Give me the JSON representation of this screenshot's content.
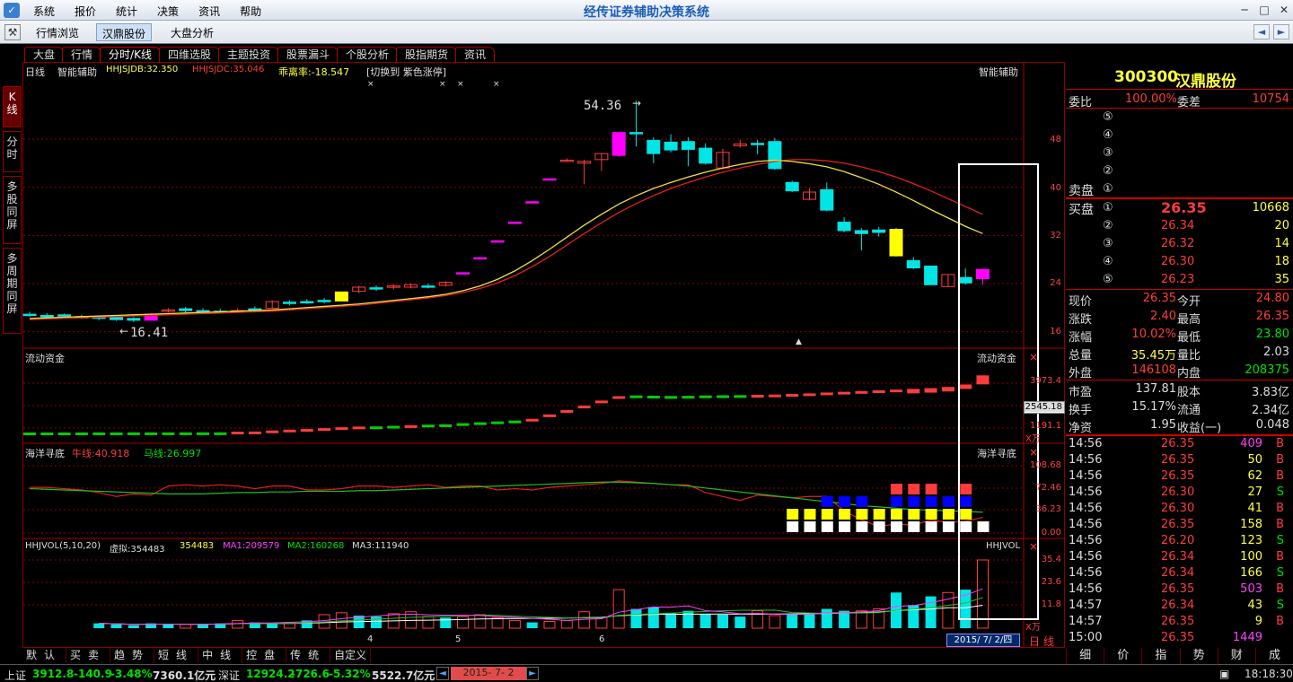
{
  "titlebar": {
    "title": "经传证券辅助决策系统",
    "menu": [
      "系统",
      "报价",
      "统计",
      "决策",
      "资讯",
      "帮助"
    ],
    "icon": "app-logo-icon"
  },
  "toolbar": {
    "buttons": [
      "行情浏览",
      "汉鼎股份",
      "大盘分析"
    ],
    "selected": "汉鼎股份"
  },
  "tabs": [
    "大盘",
    "行情",
    "分时/K线",
    "四维选股",
    "主题投资",
    "股票漏斗",
    "个股分析",
    "股指期货",
    "资讯"
  ],
  "active_tab": "分时/K线",
  "left_tabs": [
    "K线",
    "分时",
    "多股同屏",
    "多周期同屏"
  ],
  "main": {
    "header": {
      "period": "日线",
      "indicator": "智能辅助",
      "hhjsjdb": "HHJSJDB:32.350",
      "hhjsjdc": "HHJSJDC:35.046",
      "deviation": "乖离率:-18.547",
      "switch": "[切换到 紫色涨停]",
      "right_label": "智能辅助",
      "marks": [
        "×",
        "×",
        "×",
        "×"
      ]
    },
    "high_label": "54.36",
    "low_label": "16.41",
    "price_axis": [
      "48",
      "40",
      "32",
      "24",
      "16"
    ],
    "liquidity": {
      "label": "流动资金",
      "right_label": "流动资金",
      "axis": [
        "3973.4",
        "2545.18",
        "1191.1"
      ],
      "unit": "X万"
    },
    "haiyang": {
      "label": "海洋寻底",
      "niu": "牛线:40.918",
      "ma": "马线:26.997",
      "right_label": "海洋寻底",
      "axis": [
        "108.68",
        "72.46",
        "36.23",
        "0.00"
      ]
    },
    "volume": {
      "label": "HHJVOL(5,10,20)",
      "virtual": "虚拟:354483",
      "v": "354483",
      "ma1": "MA1:209579",
      "ma2": "MA2:160268",
      "ma3": "MA3:111940",
      "right_label": "HHJVOL",
      "axis": [
        "35.4",
        "23.6",
        "11.8"
      ],
      "unit": "X万"
    },
    "x_axis": [
      "4",
      "5",
      "6"
    ],
    "date_box": "2015/ 7/ 2/四",
    "period_label": "日线"
  },
  "chart_data": {
    "type": "candlestick",
    "title": "日线",
    "ylim": [
      14,
      58
    ],
    "candles": [
      {
        "o": 18.9,
        "c": 18.8,
        "h": 19.3,
        "l": 18.5,
        "col": "cyan"
      },
      {
        "o": 18.7,
        "c": 18.7,
        "h": 19.1,
        "l": 18.4,
        "col": "cyan"
      },
      {
        "o": 18.8,
        "c": 18.7,
        "h": 19.0,
        "l": 18.4,
        "col": "cyan"
      },
      {
        "o": 18.5,
        "c": 18.3,
        "h": 18.8,
        "l": 18.1,
        "col": "cyan"
      },
      {
        "o": 18.5,
        "c": 18.2,
        "h": 18.7,
        "l": 17.9,
        "col": "cyan"
      },
      {
        "o": 18.4,
        "c": 18.0,
        "h": 18.6,
        "l": 17.8,
        "col": "cyan"
      },
      {
        "o": 18.2,
        "c": 17.9,
        "h": 18.4,
        "l": 17.6,
        "col": "cyan"
      },
      {
        "o": 17.9,
        "c": 18.9,
        "h": 19.1,
        "l": 17.9,
        "col": "magenta"
      },
      {
        "o": 19.4,
        "c": 19.6,
        "h": 19.9,
        "l": 19.2,
        "col": "red"
      },
      {
        "o": 19.8,
        "c": 19.5,
        "h": 20.1,
        "l": 19.2,
        "col": "cyan"
      },
      {
        "o": 19.5,
        "c": 19.5,
        "h": 19.9,
        "l": 19.1,
        "col": "cyan"
      },
      {
        "o": 19.4,
        "c": 19.3,
        "h": 19.8,
        "l": 19.0,
        "col": "cyan"
      },
      {
        "o": 19.4,
        "c": 19.5,
        "h": 19.9,
        "l": 19.2,
        "col": "red"
      },
      {
        "o": 19.8,
        "c": 19.6,
        "h": 20.2,
        "l": 19.3,
        "col": "cyan"
      },
      {
        "o": 19.9,
        "c": 21.0,
        "h": 21.2,
        "l": 19.8,
        "col": "red"
      },
      {
        "o": 20.9,
        "c": 20.8,
        "h": 21.2,
        "l": 20.4,
        "col": "cyan"
      },
      {
        "o": 21.0,
        "c": 20.8,
        "h": 21.4,
        "l": 20.6,
        "col": "cyan"
      },
      {
        "o": 21.2,
        "c": 21.1,
        "h": 21.6,
        "l": 20.7,
        "col": "cyan"
      },
      {
        "o": 21.1,
        "c": 22.6,
        "h": 22.6,
        "l": 21.1,
        "col": "yellow"
      },
      {
        "o": 22.7,
        "c": 23.4,
        "h": 23.6,
        "l": 22.4,
        "col": "red"
      },
      {
        "o": 23.3,
        "c": 23.2,
        "h": 23.7,
        "l": 22.8,
        "col": "cyan"
      },
      {
        "o": 23.4,
        "c": 23.6,
        "h": 23.9,
        "l": 23.0,
        "col": "red"
      },
      {
        "o": 23.4,
        "c": 23.8,
        "h": 24.0,
        "l": 23.2,
        "col": "red"
      },
      {
        "o": 23.6,
        "c": 23.5,
        "h": 24.0,
        "l": 23.2,
        "col": "cyan"
      },
      {
        "o": 23.7,
        "c": 24.2,
        "h": 24.4,
        "l": 23.5,
        "col": "red"
      },
      {
        "o": 25.8,
        "c": 25.8,
        "h": 25.8,
        "l": 25.8,
        "col": "magenta"
      },
      {
        "o": 28.3,
        "c": 28.3,
        "h": 28.3,
        "l": 28.3,
        "col": "magenta"
      },
      {
        "o": 31.1,
        "c": 31.1,
        "h": 31.1,
        "l": 31.1,
        "col": "magenta"
      },
      {
        "o": 34.2,
        "c": 34.2,
        "h": 34.2,
        "l": 34.2,
        "col": "magenta"
      },
      {
        "o": 37.6,
        "c": 37.6,
        "h": 37.6,
        "l": 37.6,
        "col": "magenta"
      },
      {
        "o": 41.4,
        "c": 41.4,
        "h": 41.4,
        "l": 41.4,
        "col": "magenta"
      },
      {
        "o": 44.5,
        "c": 44.5,
        "h": 44.8,
        "l": 44.2,
        "col": "red"
      },
      {
        "o": 44.0,
        "c": 44.3,
        "h": 44.6,
        "l": 40.5,
        "col": "red"
      },
      {
        "o": 45.6,
        "c": 44.6,
        "h": 45.6,
        "l": 42.7,
        "col": "red"
      },
      {
        "o": 45.3,
        "c": 49.1,
        "h": 49.1,
        "l": 45.1,
        "col": "magenta"
      },
      {
        "o": 49.0,
        "c": 49.1,
        "h": 54.36,
        "l": 46.8,
        "col": "cyan"
      },
      {
        "o": 47.8,
        "c": 45.6,
        "h": 48.3,
        "l": 44.0,
        "col": "cyan"
      },
      {
        "o": 47.5,
        "c": 46.2,
        "h": 48.8,
        "l": 45.8,
        "col": "cyan"
      },
      {
        "o": 47.6,
        "c": 46.3,
        "h": 48.3,
        "l": 43.5,
        "col": "cyan"
      },
      {
        "o": 46.5,
        "c": 44.0,
        "h": 47.3,
        "l": 43.8,
        "col": "cyan"
      },
      {
        "o": 43.2,
        "c": 45.8,
        "h": 46.4,
        "l": 43.0,
        "col": "red"
      },
      {
        "o": 47.2,
        "c": 46.9,
        "h": 47.9,
        "l": 46.6,
        "col": "red"
      },
      {
        "o": 47.3,
        "c": 47.1,
        "h": 47.9,
        "l": 45.5,
        "col": "cyan"
      },
      {
        "o": 47.6,
        "c": 43.1,
        "h": 48.2,
        "l": 42.9,
        "col": "cyan"
      },
      {
        "o": 40.8,
        "c": 39.4,
        "h": 41.1,
        "l": 39.2,
        "col": "cyan"
      },
      {
        "o": 38.0,
        "c": 39.2,
        "h": 39.8,
        "l": 37.8,
        "col": "red"
      },
      {
        "o": 39.6,
        "c": 36.2,
        "h": 40.8,
        "l": 36.0,
        "col": "cyan"
      },
      {
        "o": 34.2,
        "c": 32.8,
        "h": 35.0,
        "l": 32.5,
        "col": "cyan"
      },
      {
        "o": 32.8,
        "c": 32.3,
        "h": 33.2,
        "l": 29.5,
        "col": "cyan"
      },
      {
        "o": 32.9,
        "c": 32.5,
        "h": 33.4,
        "l": 31.8,
        "col": "cyan"
      },
      {
        "o": 33.0,
        "c": 28.6,
        "h": 33.2,
        "l": 28.5,
        "col": "yellow"
      },
      {
        "o": 27.8,
        "c": 26.6,
        "h": 28.4,
        "l": 26.4,
        "col": "cyan"
      },
      {
        "o": 26.9,
        "c": 23.8,
        "h": 26.9,
        "l": 23.8,
        "col": "cyan"
      },
      {
        "o": 23.5,
        "c": 25.5,
        "h": 25.5,
        "l": 23.5,
        "col": "red"
      },
      {
        "o": 25.0,
        "c": 24.1,
        "h": 26.5,
        "l": 23.8,
        "col": "cyan"
      },
      {
        "o": 24.8,
        "c": 26.35,
        "h": 26.35,
        "l": 23.8,
        "col": "magenta"
      }
    ],
    "ma_short": [
      18.2,
      18.3,
      18.4,
      18.5,
      18.6,
      18.7,
      18.8,
      18.9,
      19.0,
      19.1,
      19.2,
      19.3,
      19.4,
      19.5,
      19.6,
      19.8,
      20.0,
      20.2,
      20.4,
      20.6,
      20.9,
      21.2,
      21.5,
      21.8,
      22.2,
      22.8,
      23.6,
      24.7,
      26.1,
      27.8,
      29.7,
      31.7,
      33.7,
      35.5,
      37.2,
      38.6,
      39.8,
      40.8,
      41.7,
      42.5,
      43.2,
      43.8,
      44.3,
      44.5,
      44.3,
      43.9,
      43.4,
      42.6,
      41.6,
      40.5,
      39.2,
      37.8,
      36.3,
      34.9,
      33.5,
      32.3
    ],
    "ma_long": [
      18.0,
      18.1,
      18.2,
      18.3,
      18.4,
      18.5,
      18.6,
      18.7,
      18.8,
      18.9,
      19.0,
      19.1,
      19.2,
      19.3,
      19.4,
      19.6,
      19.8,
      20.0,
      20.2,
      20.4,
      20.7,
      21.0,
      21.3,
      21.6,
      22.0,
      22.5,
      23.2,
      24.1,
      25.3,
      26.8,
      28.5,
      30.4,
      32.3,
      34.1,
      35.8,
      37.3,
      38.6,
      39.8,
      40.8,
      41.7,
      42.5,
      43.2,
      43.8,
      44.3,
      44.6,
      44.6,
      44.4,
      44.0,
      43.4,
      42.6,
      41.7,
      40.6,
      39.4,
      38.1,
      36.8,
      35.5
    ],
    "liquidity": [
      {
        "v": 60,
        "c": "green"
      },
      {
        "v": 60,
        "c": "green"
      },
      {
        "v": 62,
        "c": "green"
      },
      {
        "v": 62,
        "c": "green"
      },
      {
        "v": 64,
        "c": "green"
      },
      {
        "v": 64,
        "c": "green"
      },
      {
        "v": 66,
        "c": "green"
      },
      {
        "v": 66,
        "c": "green"
      },
      {
        "v": 68,
        "c": "green"
      },
      {
        "v": 68,
        "c": "green"
      },
      {
        "v": 70,
        "c": "green"
      },
      {
        "v": 70,
        "c": "green"
      },
      {
        "v": 120,
        "c": "red"
      },
      {
        "v": 130,
        "c": "red"
      },
      {
        "v": 200,
        "c": "red"
      },
      {
        "v": 260,
        "c": "red"
      },
      {
        "v": 300,
        "c": "red"
      },
      {
        "v": 360,
        "c": "red"
      },
      {
        "v": 420,
        "c": "red"
      },
      {
        "v": 470,
        "c": "red"
      },
      {
        "v": 480,
        "c": "green"
      },
      {
        "v": 520,
        "c": "green"
      },
      {
        "v": 560,
        "c": "red"
      },
      {
        "v": 600,
        "c": "green"
      },
      {
        "v": 620,
        "c": "green"
      },
      {
        "v": 700,
        "c": "green"
      },
      {
        "v": 760,
        "c": "green"
      },
      {
        "v": 820,
        "c": "green"
      },
      {
        "v": 880,
        "c": "green"
      },
      {
        "v": 1000,
        "c": "red"
      },
      {
        "v": 1300,
        "c": "red"
      },
      {
        "v": 1600,
        "c": "red"
      },
      {
        "v": 1900,
        "c": "red"
      },
      {
        "v": 2250,
        "c": "red"
      },
      {
        "v": 2550,
        "c": "red"
      },
      {
        "v": 2600,
        "c": "green"
      },
      {
        "v": 2580,
        "c": "green"
      },
      {
        "v": 2560,
        "c": "green"
      },
      {
        "v": 2570,
        "c": "green"
      },
      {
        "v": 2600,
        "c": "green"
      },
      {
        "v": 2610,
        "c": "green"
      },
      {
        "v": 2620,
        "c": "green"
      },
      {
        "v": 2640,
        "c": "red"
      },
      {
        "v": 2660,
        "c": "red"
      },
      {
        "v": 2700,
        "c": "red"
      },
      {
        "v": 2740,
        "c": "red"
      },
      {
        "v": 2800,
        "c": "red"
      },
      {
        "v": 2850,
        "c": "red"
      },
      {
        "v": 2900,
        "c": "red"
      },
      {
        "v": 2950,
        "c": "red"
      },
      {
        "v": 3000,
        "c": "red"
      },
      {
        "v": 3050,
        "c": "red"
      },
      {
        "v": 3100,
        "c": "red"
      },
      {
        "v": 3180,
        "c": "red"
      },
      {
        "v": 3350,
        "c": "red"
      },
      {
        "v": 3973.4,
        "c": "red"
      }
    ],
    "volume": [
      {
        "v": 2.5,
        "c": "cyan"
      },
      {
        "v": 2.0,
        "c": "cyan"
      },
      {
        "v": 1.5,
        "c": "cyan"
      },
      {
        "v": 2.5,
        "c": "cyan"
      },
      {
        "v": 2.0,
        "c": "cyan"
      },
      {
        "v": 2.0,
        "c": "red"
      },
      {
        "v": 1.8,
        "c": "cyan"
      },
      {
        "v": 2.5,
        "c": "cyan"
      },
      {
        "v": 4.0,
        "c": "red"
      },
      {
        "v": 3.0,
        "c": "cyan"
      },
      {
        "v": 2.5,
        "c": "cyan"
      },
      {
        "v": 3.0,
        "c": "red"
      },
      {
        "v": 4.0,
        "c": "cyan"
      },
      {
        "v": 7.0,
        "c": "red"
      },
      {
        "v": 8.0,
        "c": "red"
      },
      {
        "v": 6.5,
        "c": "cyan"
      },
      {
        "v": 6.0,
        "c": "cyan"
      },
      {
        "v": 7.5,
        "c": "red"
      },
      {
        "v": 8.5,
        "c": "red"
      },
      {
        "v": 6.0,
        "c": "red"
      },
      {
        "v": 5.5,
        "c": "cyan"
      },
      {
        "v": 6.0,
        "c": "red"
      },
      {
        "v": 7.0,
        "c": "red"
      },
      {
        "v": 5.5,
        "c": "red"
      },
      {
        "v": 4.0,
        "c": "red"
      },
      {
        "v": 3.0,
        "c": "cyan"
      },
      {
        "v": 3.5,
        "c": "red"
      },
      {
        "v": 4.0,
        "c": "red"
      },
      {
        "v": 8.5,
        "c": "red"
      },
      {
        "v": 5.5,
        "c": "red"
      },
      {
        "v": 20.0,
        "c": "red"
      },
      {
        "v": 10.0,
        "c": "cyan"
      },
      {
        "v": 11.0,
        "c": "cyan"
      },
      {
        "v": 8.0,
        "c": "cyan"
      },
      {
        "v": 9.0,
        "c": "cyan"
      },
      {
        "v": 7.5,
        "c": "cyan"
      },
      {
        "v": 7.0,
        "c": "cyan"
      },
      {
        "v": 6.0,
        "c": "cyan"
      },
      {
        "v": 9.0,
        "c": "red"
      },
      {
        "v": 6.5,
        "c": "red"
      },
      {
        "v": 7.0,
        "c": "cyan"
      },
      {
        "v": 7.5,
        "c": "cyan"
      },
      {
        "v": 10.0,
        "c": "cyan"
      },
      {
        "v": 9.0,
        "c": "cyan"
      },
      {
        "v": 9.0,
        "c": "red"
      },
      {
        "v": 10.0,
        "c": "red"
      },
      {
        "v": 18.5,
        "c": "cyan"
      },
      {
        "v": 12.0,
        "c": "cyan"
      },
      {
        "v": 16.5,
        "c": "cyan"
      },
      {
        "v": 18.5,
        "c": "red"
      },
      {
        "v": 20.0,
        "c": "cyan"
      },
      {
        "v": 35.4,
        "c": "red"
      }
    ]
  },
  "right_panel": {
    "code": "300300",
    "name": "汉鼎股份",
    "weibi_label": "委比",
    "weibi": "100.00%",
    "weicha_label": "委差",
    "weicha": "10754",
    "sell_label": "卖盘",
    "buy_label": "买盘",
    "sell_levels": [
      "⑤",
      "④",
      "③",
      "②",
      "①"
    ],
    "buy": [
      {
        "lvl": "①",
        "price": "26.35",
        "vol": "10668"
      },
      {
        "lvl": "②",
        "price": "26.34",
        "vol": "20"
      },
      {
        "lvl": "③",
        "price": "26.32",
        "vol": "14"
      },
      {
        "lvl": "④",
        "price": "26.30",
        "vol": "18"
      },
      {
        "lvl": "⑤",
        "price": "26.23",
        "vol": "35"
      }
    ],
    "stats": [
      {
        "l1": "现价",
        "v1": "26.35",
        "l2": "今开",
        "v2": "24.80"
      },
      {
        "l1": "涨跌",
        "v1": "2.40",
        "l2": "最高",
        "v2": "26.35"
      },
      {
        "l1": "涨幅",
        "v1": "10.02%",
        "l2": "最低",
        "v2": "23.80"
      },
      {
        "l1": "总量",
        "v1": "35.45万",
        "l2": "量比",
        "v2": "2.03"
      },
      {
        "l1": "外盘",
        "v1": "146108",
        "l2": "内盘",
        "v2": "208375"
      }
    ],
    "stats2": [
      {
        "l1": "市盈",
        "v1": "137.81",
        "l2": "股本",
        "v2": "3.83亿"
      },
      {
        "l1": "换手",
        "v1": "15.17%",
        "l2": "流通",
        "v2": "2.34亿"
      },
      {
        "l1": "净资",
        "v1": "1.95",
        "l2": "收益(一)",
        "v2": "0.048"
      }
    ],
    "ticks": [
      {
        "t": "14:56",
        "p": "26.35",
        "v": "409",
        "s": "B",
        "vc": "magenta"
      },
      {
        "t": "14:56",
        "p": "26.35",
        "v": "50",
        "s": "B",
        "vc": "yellow"
      },
      {
        "t": "14:56",
        "p": "26.35",
        "v": "62",
        "s": "B",
        "vc": "yellow"
      },
      {
        "t": "14:56",
        "p": "26.30",
        "v": "27",
        "s": "S",
        "vc": "yellow"
      },
      {
        "t": "14:56",
        "p": "26.30",
        "v": "41",
        "s": "B",
        "vc": "yellow"
      },
      {
        "t": "14:56",
        "p": "26.35",
        "v": "158",
        "s": "B",
        "vc": "yellow"
      },
      {
        "t": "14:56",
        "p": "26.20",
        "v": "123",
        "s": "S",
        "vc": "yellow"
      },
      {
        "t": "14:56",
        "p": "26.34",
        "v": "100",
        "s": "B",
        "vc": "yellow"
      },
      {
        "t": "14:56",
        "p": "26.34",
        "v": "166",
        "s": "S",
        "vc": "yellow"
      },
      {
        "t": "14:56",
        "p": "26.35",
        "v": "503",
        "s": "B",
        "vc": "magenta"
      },
      {
        "t": "14:57",
        "p": "26.34",
        "v": "43",
        "s": "S",
        "vc": "yellow"
      },
      {
        "t": "14:57",
        "p": "26.35",
        "v": "9",
        "s": "B",
        "vc": "yellow"
      },
      {
        "t": "15:00",
        "p": "26.35",
        "v": "1449",
        "s": "",
        "vc": "magenta"
      }
    ],
    "tabs": [
      "细",
      "价",
      "指",
      "势",
      "财",
      "成"
    ]
  },
  "bottom_tabs": [
    "默认",
    "买卖",
    "趋势",
    "短线",
    "中线",
    "控盘",
    "传统",
    "自定义"
  ],
  "statusbar": {
    "sh_label": "上证",
    "sh_index": "3912.8",
    "sh_chg": "-140.9",
    "sh_pct": "-3.48%",
    "sh_amt": "7360.1亿元",
    "sz_label": "深证",
    "sz_index": "12924.2",
    "sz_chg": "-726.6",
    "sz_pct": "-5.32%",
    "sz_amt": "5522.7亿元",
    "date": "2015- 7- 2",
    "time": "18:18:30"
  },
  "colors": {
    "up": "#ff3c3c",
    "down": "#00e5e5",
    "limit_up": "#ff00ff",
    "grid": "#8b0000",
    "accent": "#1d5fb5"
  }
}
